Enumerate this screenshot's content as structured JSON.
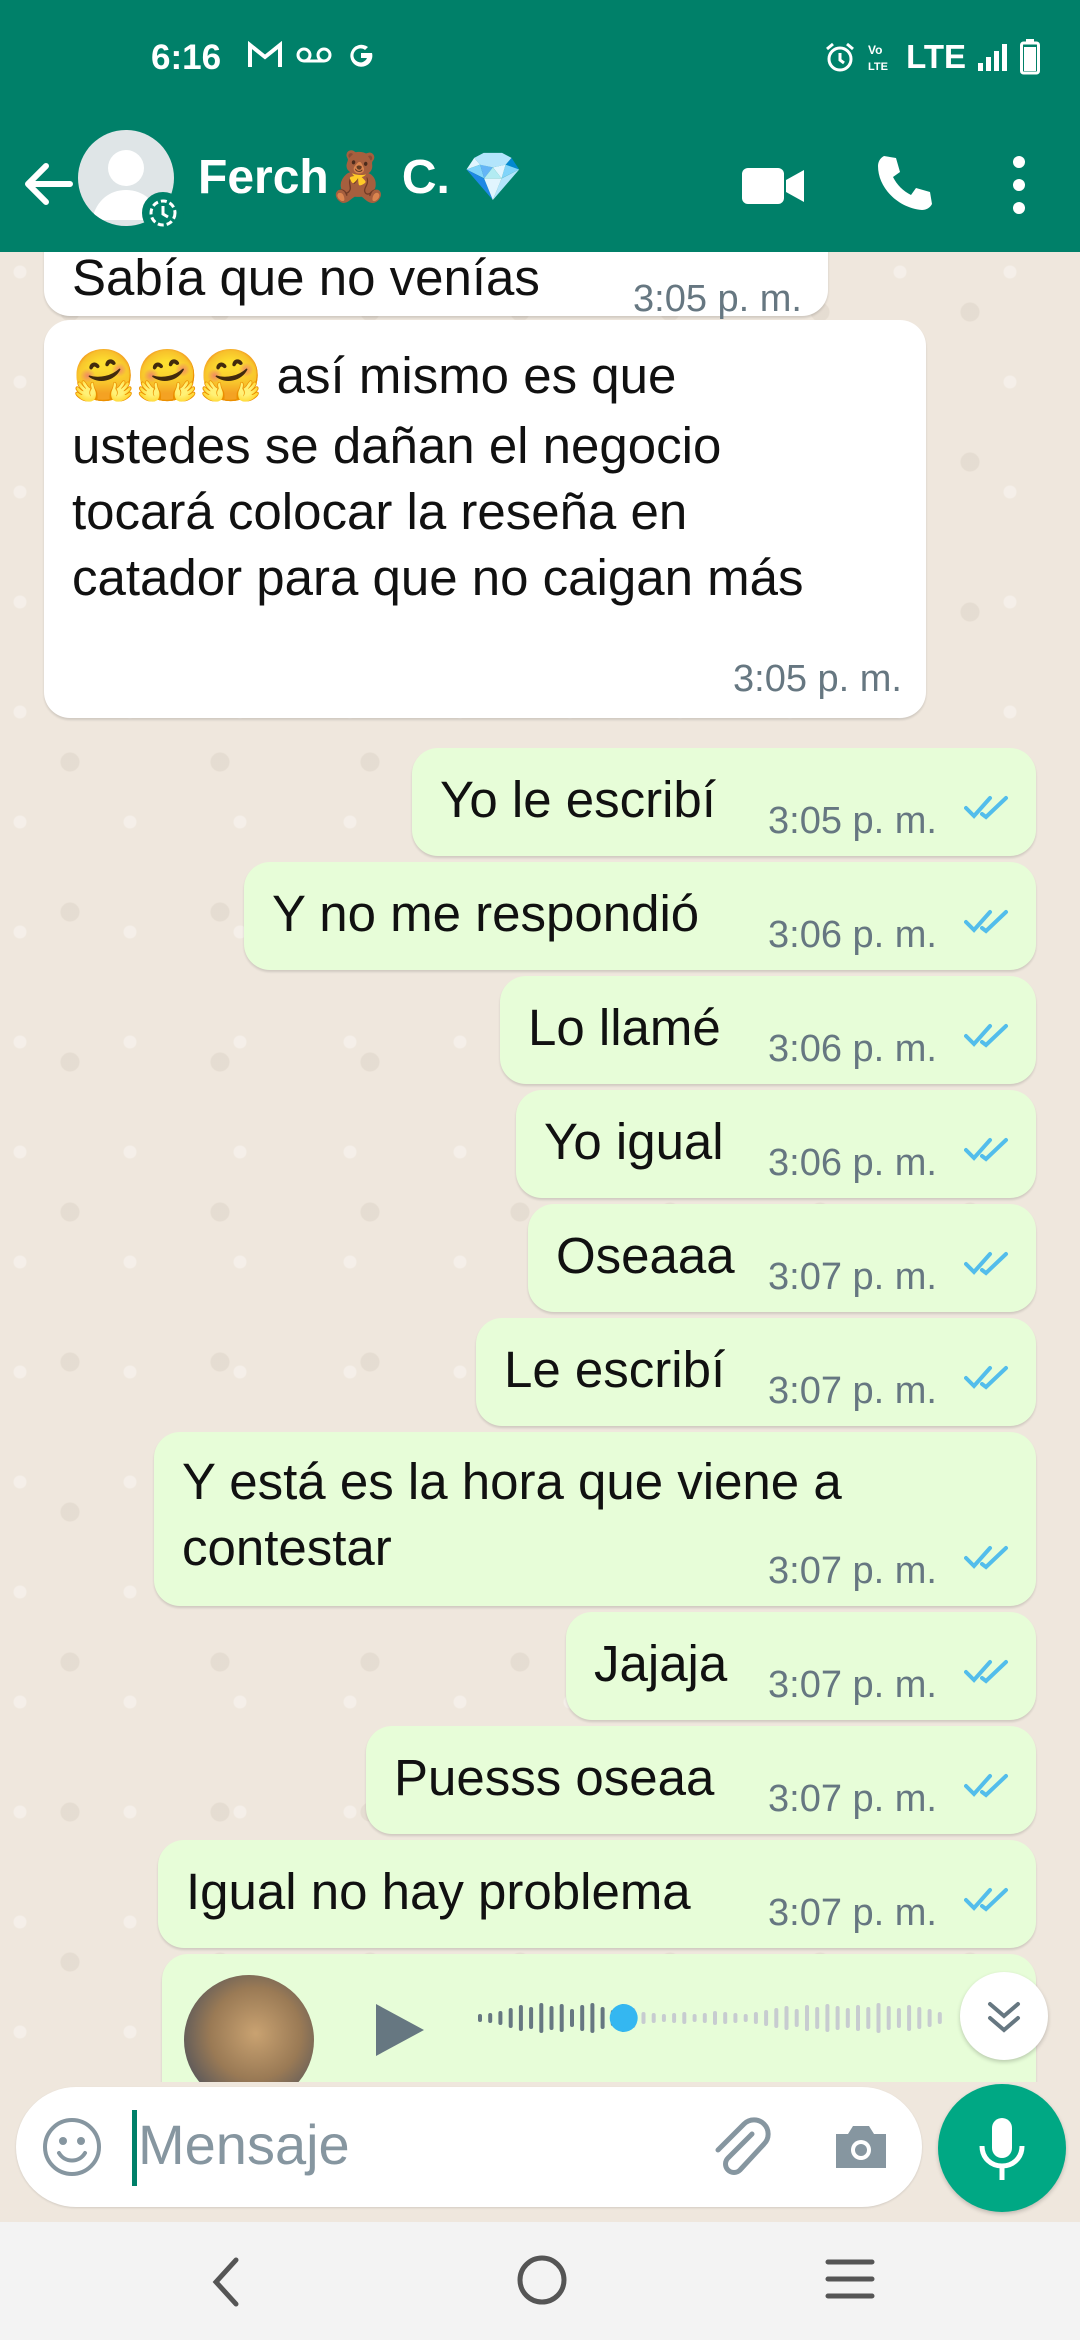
{
  "status_bar": {
    "time": "6:16",
    "network": "LTE",
    "icons": [
      "gmail-icon",
      "voicemail-icon",
      "google-icon",
      "alarm-icon",
      "volte-icon",
      "signal-icon",
      "battery-icon"
    ]
  },
  "header": {
    "contact_name": "Ferch🧸 C. 💎",
    "actions": [
      "video-call-icon",
      "phone-icon",
      "more-options-icon"
    ]
  },
  "messages": [
    {
      "direction": "in",
      "text": [
        "Sabía que no venías"
      ],
      "time": "3:05 p. m."
    },
    {
      "direction": "in",
      "text": [
        "🤗🤗🤗 así mismo es que",
        "ustedes se dañan el negocio",
        "tocará colocar la reseña en",
        "catador para que no caigan más"
      ],
      "time": "3:05 p. m."
    },
    {
      "direction": "out",
      "text": [
        "Yo le escribí"
      ],
      "time": "3:05 p. m.",
      "status": "read"
    },
    {
      "direction": "out",
      "text": [
        "Y no me respondió"
      ],
      "time": "3:06 p. m.",
      "status": "read"
    },
    {
      "direction": "out",
      "text": [
        "Lo llamé"
      ],
      "time": "3:06 p. m.",
      "status": "read"
    },
    {
      "direction": "out",
      "text": [
        "Yo igual"
      ],
      "time": "3:06 p. m.",
      "status": "read"
    },
    {
      "direction": "out",
      "text": [
        "Oseaaa"
      ],
      "time": "3:07 p. m.",
      "status": "read"
    },
    {
      "direction": "out",
      "text": [
        "Le escribí"
      ],
      "time": "3:07 p. m.",
      "status": "read"
    },
    {
      "direction": "out",
      "text": [
        "Y está es la hora que viene a",
        "contestar"
      ],
      "time": "3:07 p. m.",
      "status": "read"
    },
    {
      "direction": "out",
      "text": [
        "Jajaja"
      ],
      "time": "3:07 p. m.",
      "status": "read"
    },
    {
      "direction": "out",
      "text": [
        "Puesss oseaa"
      ],
      "time": "3:07 p. m.",
      "status": "read"
    },
    {
      "direction": "out",
      "text": [
        "Igual no hay problema"
      ],
      "time": "3:07 p. m.",
      "status": "read"
    }
  ],
  "voice_note": {
    "direction": "out",
    "playback_progress": 0.31
  },
  "composer": {
    "placeholder": "Mensaje"
  },
  "colors": {
    "header": "#008069",
    "outgoing_bubble": "#e7fdd8",
    "incoming_bubble": "#ffffff",
    "read_ticks": "#53bdeb",
    "mic_button": "#00a884"
  }
}
